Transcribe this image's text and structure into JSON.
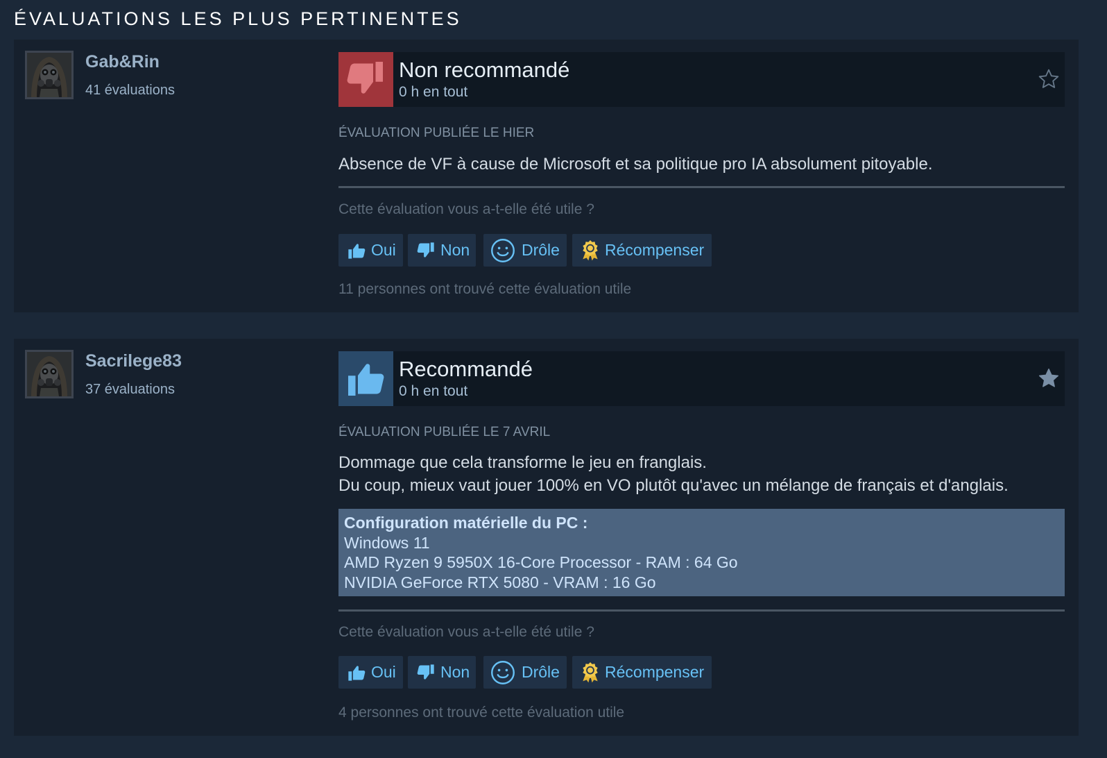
{
  "section_title": "ÉVALUATIONS LES PLUS PERTINENTES",
  "vote_question": "Cette évaluation vous a-t-elle été utile ?",
  "buttons": {
    "yes": "Oui",
    "no": "Non",
    "funny": "Drôle",
    "award": "Récompenser"
  },
  "colors": {
    "page_bg": "#1b2838",
    "card_bg": "#16202d",
    "negative": "#a0353b",
    "positive_bg": "#2a4a6a",
    "link": "#67c1f5",
    "hardware_bg": "#4c6480"
  },
  "reviews": [
    {
      "author": "Gab&Rin",
      "review_count": "41 évaluations",
      "verdict": "Non recommandé",
      "verdict_icon": "thumbs-down-icon",
      "hours": "0 h en tout",
      "favorited": false,
      "posted": "ÉVALUATION PUBLIÉE LE HIER",
      "text_lines": [
        "Absence de VF à cause de Microsoft et sa politique pro IA absolument pitoyable."
      ],
      "helpful_count": "11 personnes ont trouvé cette évaluation utile"
    },
    {
      "author": "Sacrilege83",
      "review_count": "37 évaluations",
      "verdict": "Recommandé",
      "verdict_icon": "thumbs-up-icon",
      "hours": "0 h en tout",
      "favorited": true,
      "posted": "ÉVALUATION PUBLIÉE LE 7 AVRIL",
      "text_lines": [
        "Dommage que cela transforme le jeu en franglais.",
        "Du coup, mieux vaut jouer 100% en VO plutôt qu'avec un mélange de français et d'anglais."
      ],
      "hardware": {
        "title": "Configuration matérielle du PC :",
        "lines": [
          "Windows 11",
          "AMD Ryzen 9 5950X 16-Core Processor - RAM : 64 Go",
          "NVIDIA GeForce RTX 5080 - VRAM : 16 Go"
        ]
      },
      "helpful_count": "4 personnes ont trouvé cette évaluation utile"
    }
  ]
}
